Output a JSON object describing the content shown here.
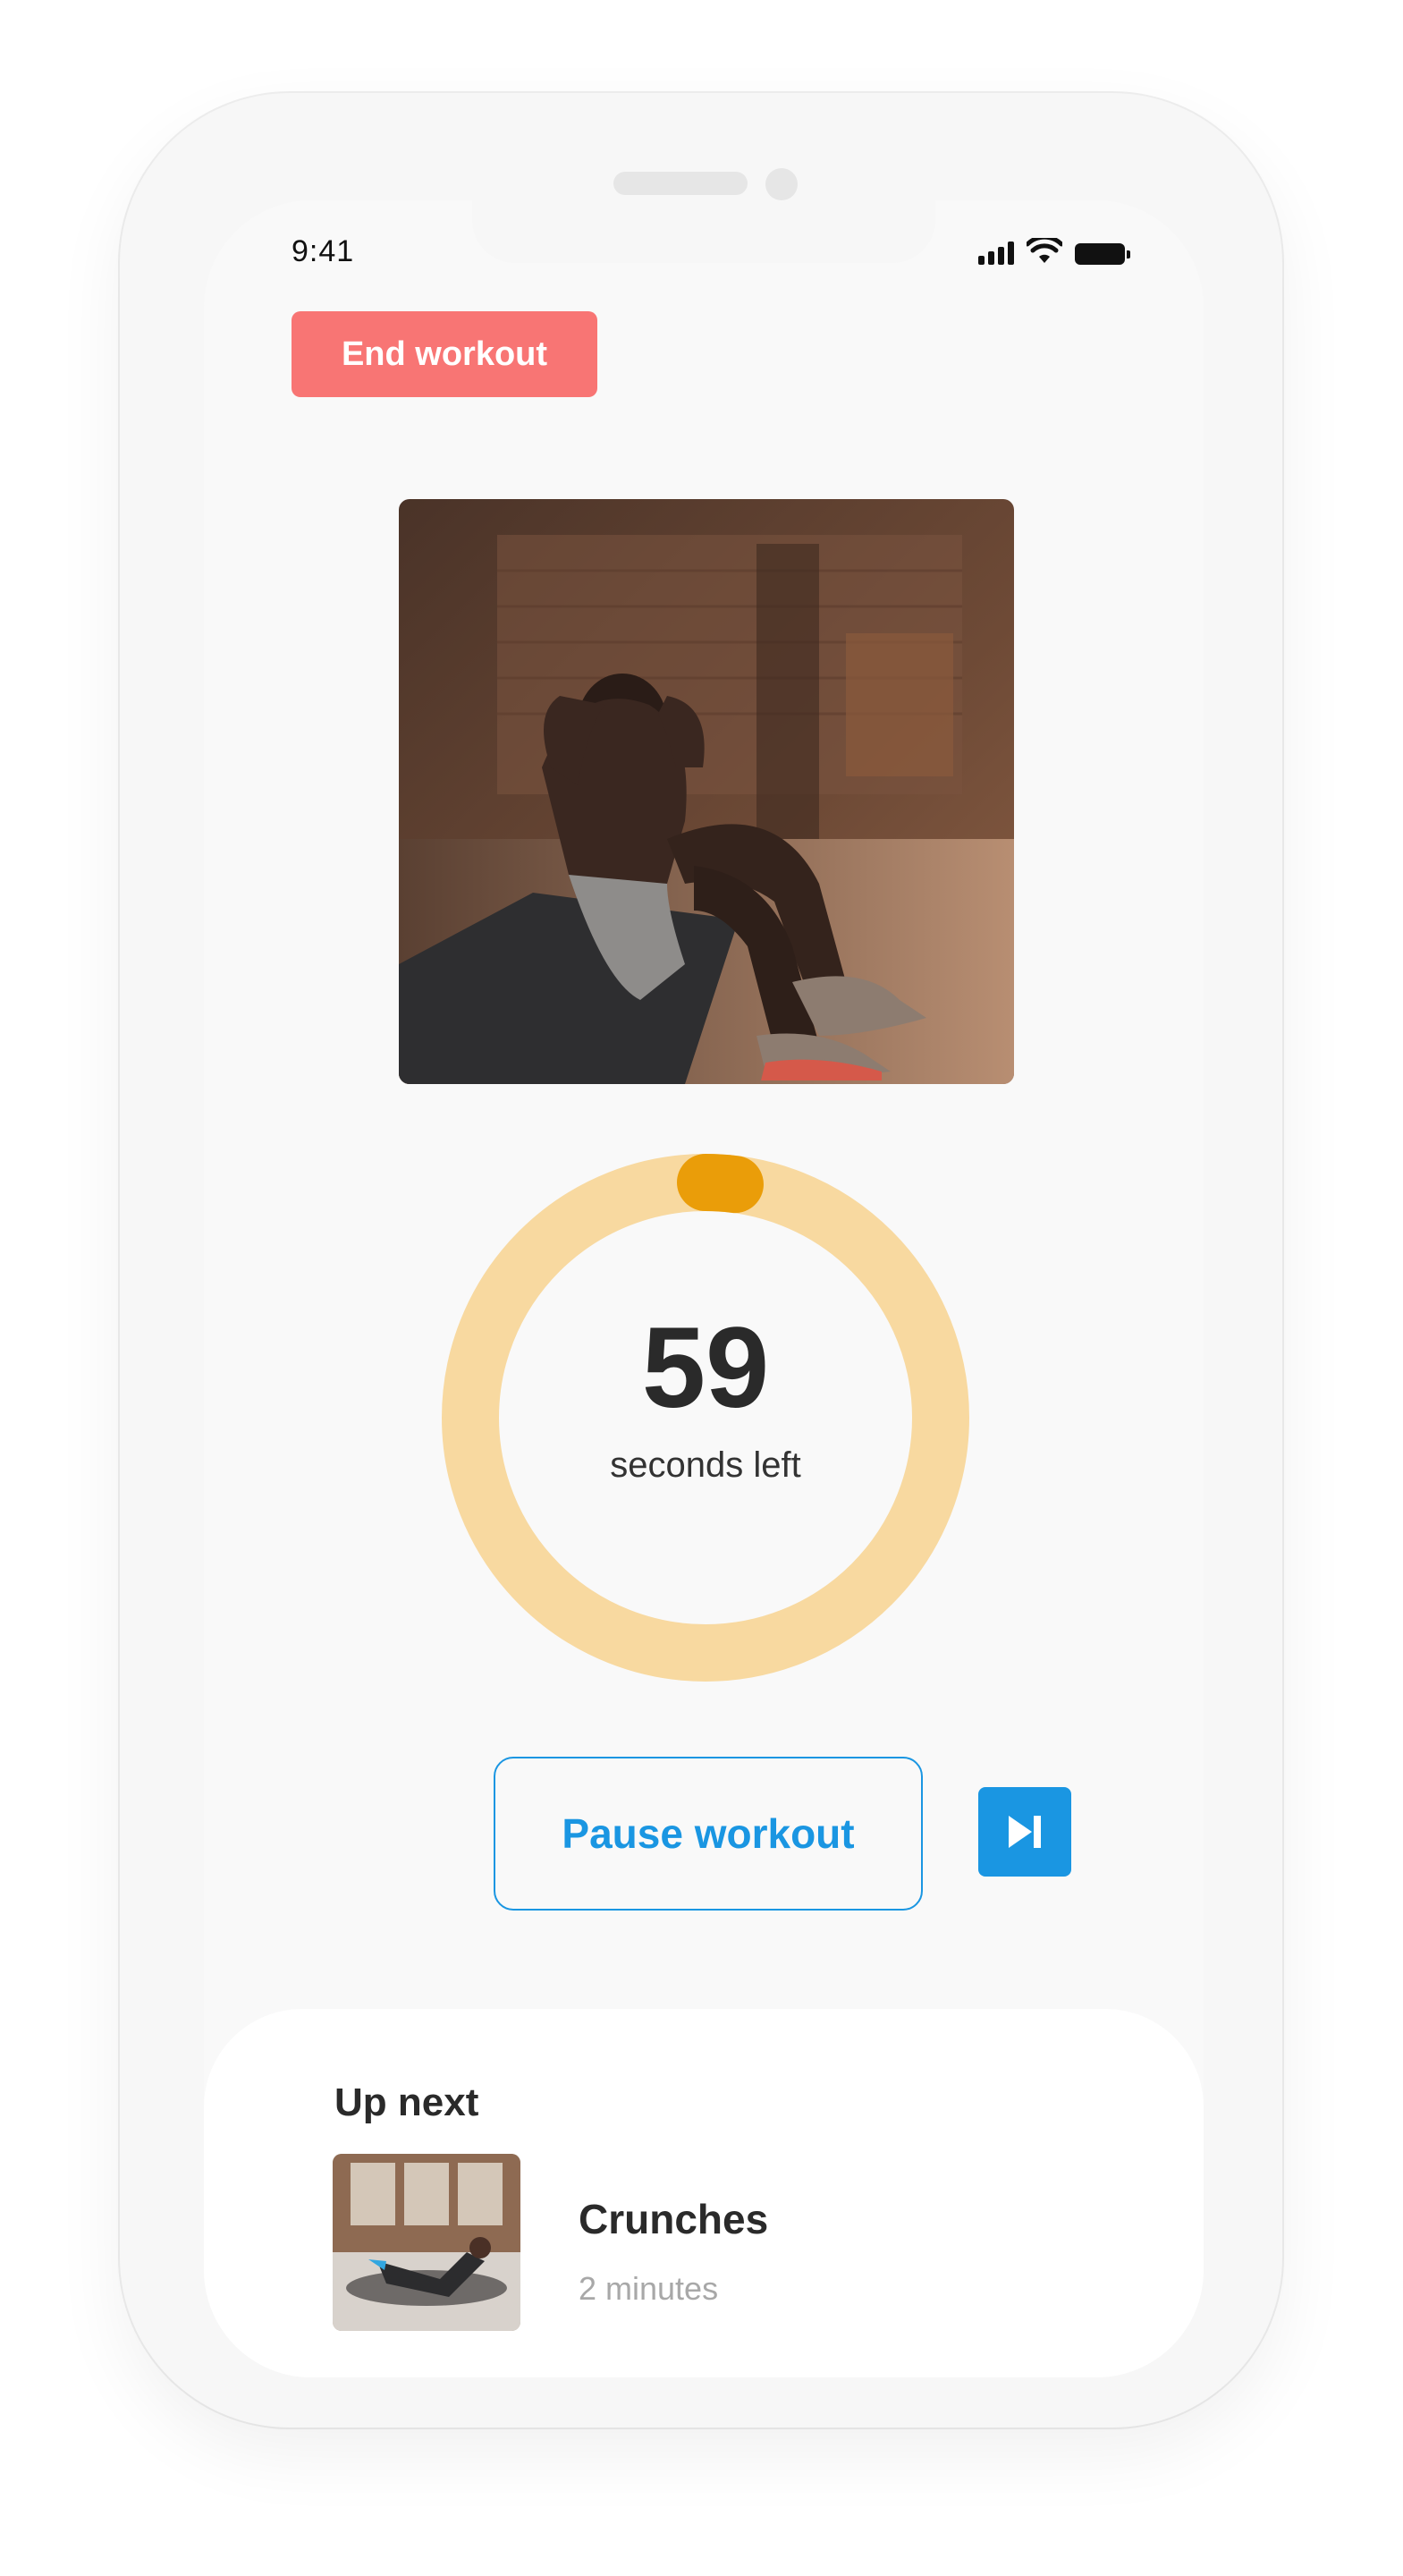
{
  "status_bar": {
    "time": "9:41",
    "signal_icon": "cellular-signal-icon",
    "wifi_icon": "wifi-icon",
    "battery_icon": "battery-icon"
  },
  "header": {
    "end_workout_label": "End workout"
  },
  "exercise": {
    "image_icon": "person-doing-situps-photo"
  },
  "timer": {
    "value": "59",
    "label": "seconds left",
    "progress_fraction": 0.02,
    "track_color": "#f8d9a0",
    "progress_color": "#ea9d09"
  },
  "controls": {
    "pause_label": "Pause workout",
    "skip_icon": "skip-next-icon",
    "accent_color": "#1a96e2"
  },
  "up_next": {
    "title": "Up next",
    "items": [
      {
        "name": "Crunches",
        "duration": "2 minutes",
        "thumb_icon": "crunches-photo"
      }
    ]
  },
  "colors": {
    "end_button": "#f87574",
    "screen_bg": "#f9f9f9"
  }
}
